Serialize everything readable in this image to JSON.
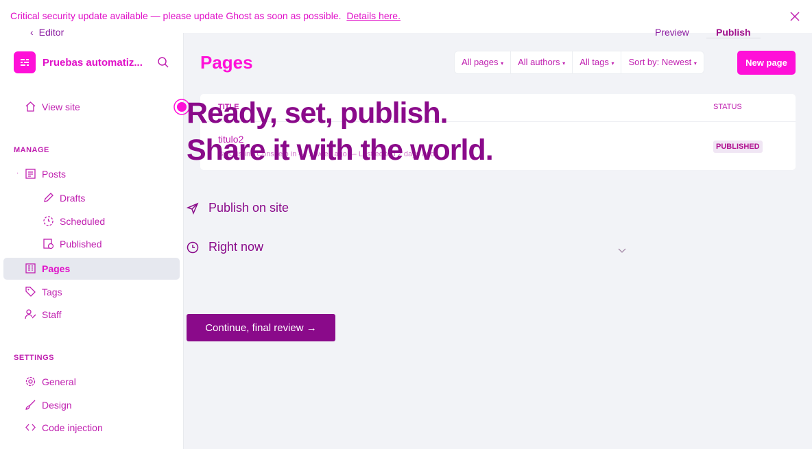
{
  "banner": {
    "message": "Critical security update available — please update Ghost as soon as possible.",
    "link": "Details here."
  },
  "editor": {
    "back_label": "Editor",
    "preview_label": "Preview",
    "publish_label": "Publish"
  },
  "sidebar": {
    "site_name": "Pruebas automatiz...",
    "view_site": "View site",
    "manage_label": "MANAGE",
    "items": [
      {
        "label": "Posts",
        "icon": "posts-icon"
      },
      {
        "label": "Drafts",
        "icon": "pencil-icon"
      },
      {
        "label": "Scheduled",
        "icon": "clock-icon"
      },
      {
        "label": "Published",
        "icon": "published-icon"
      },
      {
        "label": "Pages",
        "icon": "pages-icon"
      },
      {
        "label": "Tags",
        "icon": "tag-icon"
      },
      {
        "label": "Staff",
        "icon": "staff-icon"
      }
    ],
    "settings_label": "SETTINGS",
    "settings_items": [
      {
        "label": "General",
        "icon": "gear-icon"
      },
      {
        "label": "Design",
        "icon": "brush-icon"
      },
      {
        "label": "Code injection",
        "icon": "code-icon"
      }
    ]
  },
  "main": {
    "title": "Pages",
    "filters": [
      "All pages",
      "All authors",
      "All tags",
      "Sort by: Newest"
    ],
    "new_page_label": "New page",
    "list": {
      "col_title": "TITLE",
      "col_status": "STATUS",
      "rows": [
        {
          "title": "titulo2",
          "meta": "By Cristina Consuelo in — 1 week ago — Last edited 2 days ago",
          "status": "PUBLISHED"
        }
      ]
    }
  },
  "publish": {
    "headline_1": "Ready, set, publish.",
    "headline_2": "Share it with the world.",
    "option_publish": "Publish on site",
    "option_time": "Right now",
    "continue_label": "Continue, final review →"
  },
  "colors": {
    "accent": "#ff10d8",
    "publish_purple": "#8a0a8a",
    "sidebar_text": "#c020b0"
  }
}
